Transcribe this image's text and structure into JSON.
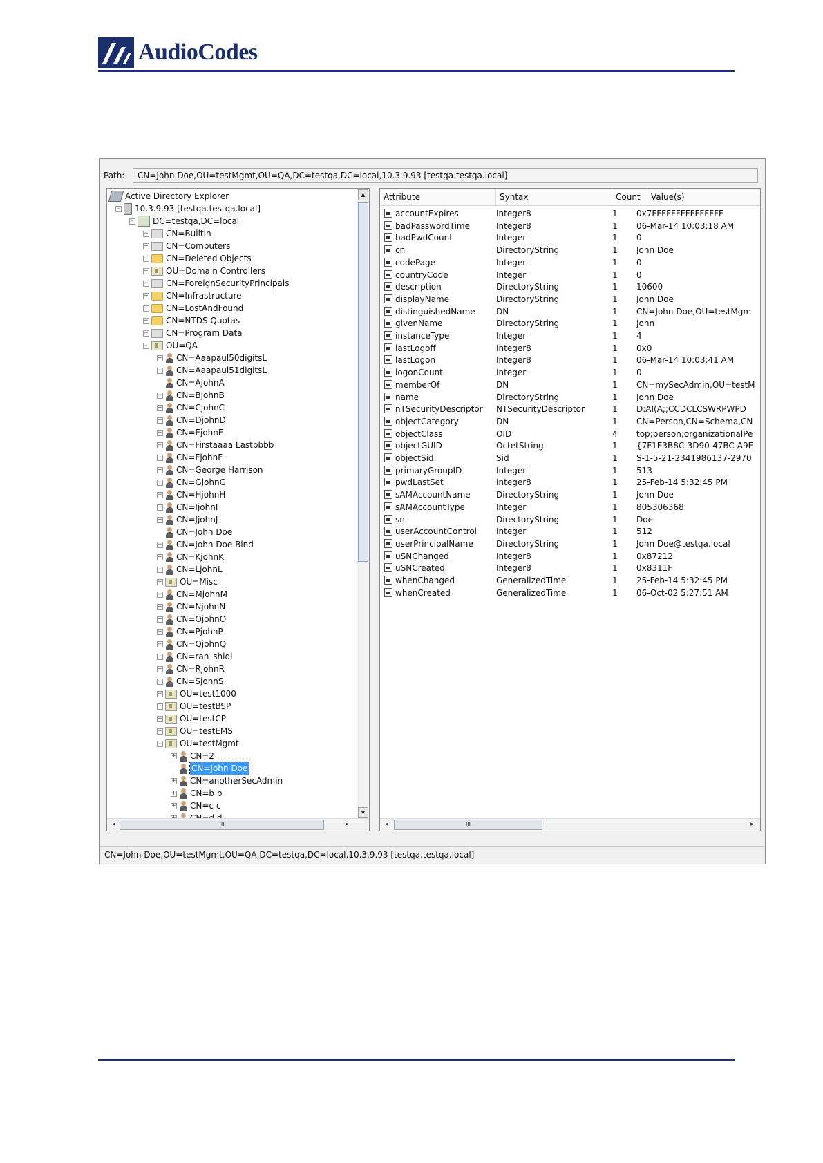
{
  "logo": {
    "brand": "AudioCodes"
  },
  "path": {
    "label": "Path:",
    "value": "CN=John Doe,OU=testMgmt,OU=QA,DC=testqa,DC=local,10.3.9.93 [testqa.testqa.local]"
  },
  "tree": {
    "items": [
      {
        "label": "Active Directory Explorer",
        "level": 0,
        "icon": "ade",
        "exp": "none"
      },
      {
        "label": "10.3.9.93 [testqa.testqa.local]",
        "level": 1,
        "icon": "server",
        "exp": "-"
      },
      {
        "label": "DC=testqa,DC=local",
        "level": 2,
        "icon": "domain",
        "exp": "-"
      },
      {
        "label": "CN=Builtin",
        "level": 3,
        "icon": "cont",
        "exp": "+"
      },
      {
        "label": "CN=Computers",
        "level": 3,
        "icon": "cont",
        "exp": "+"
      },
      {
        "label": "CN=Deleted Objects",
        "level": 3,
        "icon": "folder",
        "exp": "+"
      },
      {
        "label": "OU=Domain Controllers",
        "level": 3,
        "icon": "ou",
        "exp": "+"
      },
      {
        "label": "CN=ForeignSecurityPrincipals",
        "level": 3,
        "icon": "cont",
        "exp": "+"
      },
      {
        "label": "CN=Infrastructure",
        "level": 3,
        "icon": "folder",
        "exp": "+"
      },
      {
        "label": "CN=LostAndFound",
        "level": 3,
        "icon": "folder",
        "exp": "+"
      },
      {
        "label": "CN=NTDS Quotas",
        "level": 3,
        "icon": "folder",
        "exp": "+"
      },
      {
        "label": "CN=Program Data",
        "level": 3,
        "icon": "cont",
        "exp": "+"
      },
      {
        "label": "OU=QA",
        "level": 3,
        "icon": "ou",
        "exp": "-"
      },
      {
        "label": "CN=Aaapaul50digitsL",
        "level": 4,
        "icon": "user",
        "exp": "+"
      },
      {
        "label": "CN=Aaapaul51digitsL",
        "level": 4,
        "icon": "user",
        "exp": "+"
      },
      {
        "label": "CN=AjohnA",
        "level": 4,
        "icon": "user",
        "exp": "none"
      },
      {
        "label": "CN=BjohnB",
        "level": 4,
        "icon": "user",
        "exp": "+"
      },
      {
        "label": "CN=CjohnC",
        "level": 4,
        "icon": "user",
        "exp": "+"
      },
      {
        "label": "CN=DjohnD",
        "level": 4,
        "icon": "user",
        "exp": "+"
      },
      {
        "label": "CN=EjohnE",
        "level": 4,
        "icon": "user",
        "exp": "+"
      },
      {
        "label": "CN=Firstaaaa Lastbbbb",
        "level": 4,
        "icon": "user",
        "exp": "+"
      },
      {
        "label": "CN=FjohnF",
        "level": 4,
        "icon": "user",
        "exp": "+"
      },
      {
        "label": "CN=George Harrison",
        "level": 4,
        "icon": "user",
        "exp": "+"
      },
      {
        "label": "CN=GjohnG",
        "level": 4,
        "icon": "user",
        "exp": "+"
      },
      {
        "label": "CN=HjohnH",
        "level": 4,
        "icon": "user",
        "exp": "+"
      },
      {
        "label": "CN=IjohnI",
        "level": 4,
        "icon": "user",
        "exp": "+"
      },
      {
        "label": "CN=JjohnJ",
        "level": 4,
        "icon": "user",
        "exp": "+"
      },
      {
        "label": "CN=John Doe",
        "level": 4,
        "icon": "user",
        "exp": "none"
      },
      {
        "label": "CN=John Doe Bind",
        "level": 4,
        "icon": "user",
        "exp": "+"
      },
      {
        "label": "CN=KjohnK",
        "level": 4,
        "icon": "user",
        "exp": "+"
      },
      {
        "label": "CN=LjohnL",
        "level": 4,
        "icon": "user",
        "exp": "+"
      },
      {
        "label": "OU=Misc",
        "level": 4,
        "icon": "ou",
        "exp": "+"
      },
      {
        "label": "CN=MjohnM",
        "level": 4,
        "icon": "user",
        "exp": "+"
      },
      {
        "label": "CN=NjohnN",
        "level": 4,
        "icon": "user",
        "exp": "+"
      },
      {
        "label": "CN=OjohnO",
        "level": 4,
        "icon": "user",
        "exp": "+"
      },
      {
        "label": "CN=PjohnP",
        "level": 4,
        "icon": "user",
        "exp": "+"
      },
      {
        "label": "CN=QjohnQ",
        "level": 4,
        "icon": "user",
        "exp": "+"
      },
      {
        "label": "CN=ran_shidi",
        "level": 4,
        "icon": "user",
        "exp": "+"
      },
      {
        "label": "CN=RjohnR",
        "level": 4,
        "icon": "user",
        "exp": "+"
      },
      {
        "label": "CN=SjohnS",
        "level": 4,
        "icon": "user",
        "exp": "+"
      },
      {
        "label": "OU=test1000",
        "level": 4,
        "icon": "ou",
        "exp": "+"
      },
      {
        "label": "OU=testBSP",
        "level": 4,
        "icon": "ou",
        "exp": "+"
      },
      {
        "label": "OU=testCP",
        "level": 4,
        "icon": "ou",
        "exp": "+"
      },
      {
        "label": "OU=testEMS",
        "level": 4,
        "icon": "ou",
        "exp": "+"
      },
      {
        "label": "OU=testMgmt",
        "level": 4,
        "icon": "ou",
        "exp": "-"
      },
      {
        "label": "CN=2",
        "level": 5,
        "icon": "user",
        "exp": "+"
      },
      {
        "label": "CN=John Doe",
        "level": 5,
        "icon": "user",
        "exp": "none",
        "selected": true
      },
      {
        "label": "CN=anotherSecAdmin",
        "level": 5,
        "icon": "user",
        "exp": "+"
      },
      {
        "label": "CN=b b",
        "level": 5,
        "icon": "user",
        "exp": "+"
      },
      {
        "label": "CN=c c",
        "level": 5,
        "icon": "user",
        "exp": "+"
      },
      {
        "label": "CN=d d",
        "level": 5,
        "icon": "user",
        "exp": "+"
      }
    ]
  },
  "list": {
    "columns": [
      "Attribute",
      "Syntax",
      "Count",
      "Value(s)"
    ],
    "rows": [
      [
        "accountExpires",
        "Integer8",
        "1",
        "0x7FFFFFFFFFFFFFFF"
      ],
      [
        "badPasswordTime",
        "Integer8",
        "1",
        "06-Mar-14 10:03:18 AM"
      ],
      [
        "badPwdCount",
        "Integer",
        "1",
        "0"
      ],
      [
        "cn",
        "DirectoryString",
        "1",
        "John Doe"
      ],
      [
        "codePage",
        "Integer",
        "1",
        "0"
      ],
      [
        "countryCode",
        "Integer",
        "1",
        "0"
      ],
      [
        "description",
        "DirectoryString",
        "1",
        "10600"
      ],
      [
        "displayName",
        "DirectoryString",
        "1",
        "John Doe"
      ],
      [
        "distinguishedName",
        "DN",
        "1",
        "CN=John Doe,OU=testMgm"
      ],
      [
        "givenName",
        "DirectoryString",
        "1",
        "John"
      ],
      [
        "instanceType",
        "Integer",
        "1",
        "4"
      ],
      [
        "lastLogoff",
        "Integer8",
        "1",
        "0x0"
      ],
      [
        "lastLogon",
        "Integer8",
        "1",
        "06-Mar-14 10:03:41 AM"
      ],
      [
        "logonCount",
        "Integer",
        "1",
        "0"
      ],
      [
        "memberOf",
        "DN",
        "1",
        "CN=mySecAdmin,OU=testM"
      ],
      [
        "name",
        "DirectoryString",
        "1",
        "John Doe"
      ],
      [
        "nTSecurityDescriptor",
        "NTSecurityDescriptor",
        "1",
        "D:AI(A;;CCDCLCSWRPWPD"
      ],
      [
        "objectCategory",
        "DN",
        "1",
        "CN=Person,CN=Schema,CN"
      ],
      [
        "objectClass",
        "OID",
        "4",
        "top;person;organizationalPe"
      ],
      [
        "objectGUID",
        "OctetString",
        "1",
        "{7F1E3B8C-3D90-47BC-A9E"
      ],
      [
        "objectSid",
        "Sid",
        "1",
        "S-1-5-21-2341986137-2970"
      ],
      [
        "primaryGroupID",
        "Integer",
        "1",
        "513"
      ],
      [
        "pwdLastSet",
        "Integer8",
        "1",
        "25-Feb-14 5:32:45 PM"
      ],
      [
        "sAMAccountName",
        "DirectoryString",
        "1",
        "John Doe"
      ],
      [
        "sAMAccountType",
        "Integer",
        "1",
        "805306368"
      ],
      [
        "sn",
        "DirectoryString",
        "1",
        "Doe"
      ],
      [
        "userAccountControl",
        "Integer",
        "1",
        "512"
      ],
      [
        "userPrincipalName",
        "DirectoryString",
        "1",
        "John Doe@testqa.local"
      ],
      [
        "uSNChanged",
        "Integer8",
        "1",
        "0x87212"
      ],
      [
        "uSNCreated",
        "Integer8",
        "1",
        "0x8311F"
      ],
      [
        "whenChanged",
        "GeneralizedTime",
        "1",
        "25-Feb-14 5:32:45 PM"
      ],
      [
        "whenCreated",
        "GeneralizedTime",
        "1",
        "06-Oct-02 5:27:51 AM"
      ]
    ]
  },
  "status": {
    "text": "CN=John Doe,OU=testMgmt,OU=QA,DC=testqa,DC=local,10.3.9.93 [testqa.testqa.local]"
  }
}
